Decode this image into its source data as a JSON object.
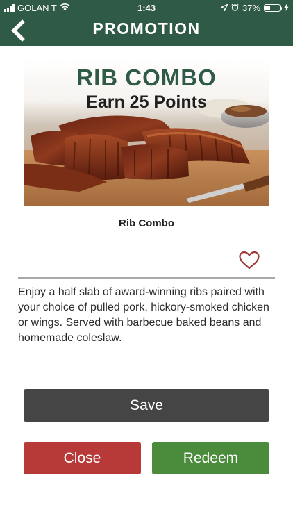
{
  "status_bar": {
    "carrier": "GOLAN T",
    "time": "1:43",
    "battery_percent": "37%",
    "battery_level": 0.37,
    "icons": [
      "signal-icon",
      "wifi-icon",
      "location-icon",
      "alarm-icon",
      "battery-icon",
      "charging-icon"
    ]
  },
  "nav": {
    "title": "PROMOTION",
    "back_icon": "back-chevron-icon"
  },
  "promo": {
    "headline": "RIB COMBO",
    "subheadline": "Earn 25 Points",
    "image": "rib-combo-photo"
  },
  "item": {
    "title": "Rib Combo",
    "favorite_icon": "heart-outline-icon",
    "description": "Enjoy a half slab of award-winning ribs paired with your choice of pulled pork, hickory-smoked chicken or wings. Served with barbecue baked beans and homemade coleslaw."
  },
  "actions": {
    "save_label": "Save",
    "close_label": "Close",
    "redeem_label": "Redeem"
  },
  "colors": {
    "header_green": "#2f5a45",
    "save_gray": "#454545",
    "close_red": "#b83a38",
    "redeem_green": "#4a8c3c",
    "heart_red": "#9c3a36"
  }
}
